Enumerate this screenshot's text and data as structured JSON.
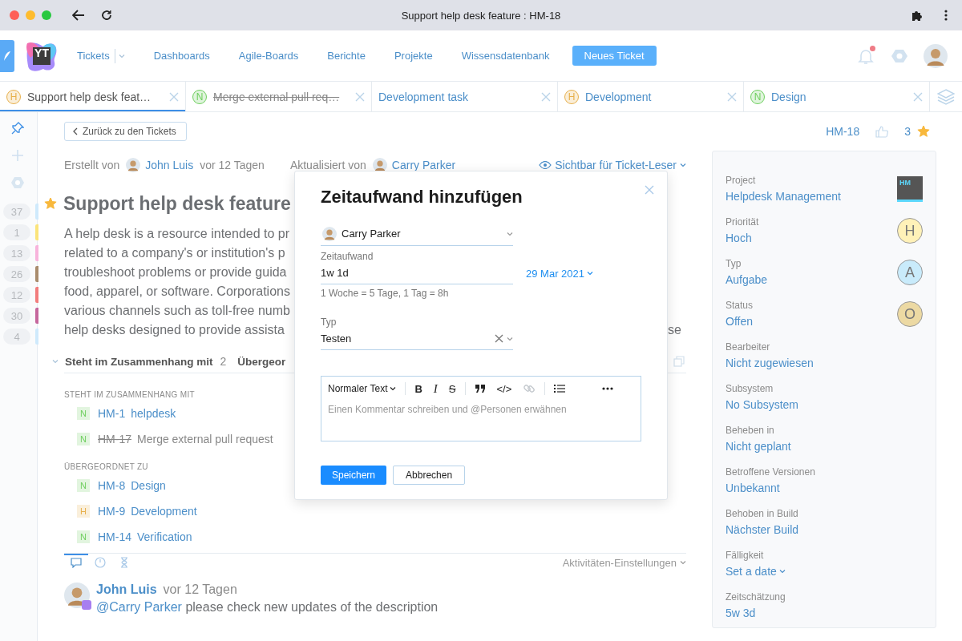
{
  "browser": {
    "title": "Support help desk feature : HM-18"
  },
  "header": {
    "logo": "YT",
    "nav": [
      {
        "label": "Tickets",
        "dropdown": true
      },
      {
        "label": "Dashboards",
        "dropdown": false
      },
      {
        "label": "Agile-Boards",
        "dropdown": false
      },
      {
        "label": "Berichte",
        "dropdown": false
      },
      {
        "label": "Projekte",
        "dropdown": false
      },
      {
        "label": "Wissensdatenbank",
        "dropdown": false
      }
    ],
    "new_button": "Neues Ticket",
    "unread_notifications": true
  },
  "tabs": [
    {
      "badge": "H",
      "color": "#e7b04c",
      "label": "Support help desk feat…",
      "selected": true,
      "resolved": false
    },
    {
      "badge": "N",
      "color": "#6fcf5f",
      "label": "Merge external pull req…",
      "selected": false,
      "resolved": true
    },
    {
      "label": "Development task",
      "selected": false,
      "resolved": false
    },
    {
      "badge": "H",
      "color": "#e7b04c",
      "label": "Development",
      "selected": false,
      "resolved": false
    },
    {
      "badge": "N",
      "color": "#6fcf5f",
      "label": "Design",
      "selected": false,
      "resolved": false
    }
  ],
  "sidebar": {
    "counts": [
      {
        "count": "37",
        "color": "#cfeafc"
      },
      {
        "count": "1",
        "color": "#fbe47a"
      },
      {
        "count": "13",
        "color": "#f8b4dc"
      },
      {
        "count": "26",
        "color": "#a98c6d"
      },
      {
        "count": "12",
        "color": "#f27d7d"
      },
      {
        "count": "30",
        "color": "#c6679d"
      },
      {
        "count": "4",
        "color": "#cfeafc"
      }
    ]
  },
  "back_button": "Zurück zu den Tickets",
  "issue_id": "HM-18",
  "votes": "3",
  "starred": true,
  "issue": {
    "created_label": "Erstellt von",
    "creator": "John Luis",
    "created_ago": "vor 12 Tagen",
    "updated_label": "Aktualisiert von",
    "updater": "Carry Parker",
    "visibility": "Sichtbar für Ticket-Leser",
    "title": "Support help desk feature",
    "starred": true,
    "description": [
      {
        "left": "A help desk is a resource intended to pr"
      },
      {
        "left": "related to a company's or institution's p"
      },
      {
        "left": "troubleshoot problems or provide guida"
      },
      {
        "left": "food, apparel, or software. Corporations"
      },
      {
        "left": "various channels such as toll-free numb"
      },
      {
        "left": "help desks designed to provide assista",
        "right": "se"
      }
    ]
  },
  "relations": {
    "tabs": [
      {
        "label": "Steht im Zusammenhang mit",
        "count": "2"
      },
      {
        "label": "Übergeor"
      }
    ],
    "groups": [
      {
        "title": "STEHT IM ZUSAMMENHANG MIT",
        "items": [
          {
            "badge": "N",
            "color": "#6fcf5f",
            "id": "HM-1",
            "summary": "helpdesk",
            "resolved": false
          },
          {
            "badge": "N",
            "color": "#6fcf5f",
            "id": "HM-17",
            "summary": "Merge external pull request",
            "resolved": true
          }
        ]
      },
      {
        "title": "ÜBERGEORDNET ZU",
        "items": [
          {
            "badge": "N",
            "color": "#6fcf5f",
            "id": "HM-8",
            "summary": "Design",
            "resolved": false
          },
          {
            "badge": "H",
            "color": "#e7b04c",
            "id": "HM-9",
            "summary": "Development",
            "resolved": false
          },
          {
            "badge": "N",
            "color": "#6fcf5f",
            "id": "HM-14",
            "summary": "Verification",
            "resolved": false
          }
        ]
      }
    ]
  },
  "activity": {
    "tabs": [
      {
        "kind": "comments",
        "selected": true
      },
      {
        "kind": "timer",
        "selected": false
      },
      {
        "kind": "history",
        "selected": false
      }
    ],
    "settings": "Aktivitäten-Einstellungen"
  },
  "comment": {
    "author": "John Luis",
    "ago": "vor 12 Tagen",
    "mention": "@Carry Parker",
    "text": "please check new updates of the description"
  },
  "fields": [
    {
      "label": "Project",
      "value": "Helpdesk Management",
      "kind": "project",
      "badge": "HM"
    },
    {
      "label": "Priorität",
      "value": "Hoch",
      "kind": "letter",
      "badge": "H",
      "color": "#fff1b8"
    },
    {
      "label": "Typ",
      "value": "Aufgabe",
      "kind": "letter",
      "badge": "A",
      "color": "#c9ebfb"
    },
    {
      "label": "Status",
      "value": "Offen",
      "kind": "letter",
      "badge": "O",
      "color": "#ecd9a3"
    },
    {
      "label": "Bearbeiter",
      "value": "Nicht zugewiesen",
      "kind": "plain"
    },
    {
      "label": "Subsystem",
      "value": "No Subsystem",
      "kind": "plain"
    },
    {
      "label": "Beheben in",
      "value": "Nicht geplant",
      "kind": "plain"
    },
    {
      "label": "Betroffene Versionen",
      "value": "Unbekannt",
      "kind": "plain"
    },
    {
      "label": "Behoben in Build",
      "value": "Nächster Build",
      "kind": "plain"
    },
    {
      "label": "Fälligkeit",
      "value": "Set a date",
      "kind": "date"
    },
    {
      "label": "Zeitschätzung",
      "value": "5w 3d",
      "kind": "plain"
    }
  ],
  "dialog": {
    "title": "Zeitaufwand hinzufügen",
    "author": "Carry Parker",
    "spent_label": "Zeitaufwand",
    "spent_value": "1w 1d",
    "date": "29 Mar 2021",
    "hint": "1 Woche = 5 Tage, 1 Tag = 8h",
    "type_label": "Typ",
    "type_value": "Testen",
    "toolbar": [
      {
        "kind": "format",
        "label": "Normaler Text"
      },
      {
        "kind": "separator"
      },
      {
        "kind": "bold",
        "label": "B"
      },
      {
        "kind": "italic",
        "label": "I"
      },
      {
        "kind": "strike",
        "label": "S"
      },
      {
        "kind": "separator"
      },
      {
        "kind": "quote"
      },
      {
        "kind": "code",
        "label": "</>"
      },
      {
        "kind": "link",
        "disabled": true
      },
      {
        "kind": "separator"
      },
      {
        "kind": "list"
      },
      {
        "kind": "more"
      }
    ],
    "comment_placeholder": "Einen Kommentar schreiben und @Personen erwähnen",
    "save": "Speichern",
    "cancel": "Abbrechen"
  }
}
